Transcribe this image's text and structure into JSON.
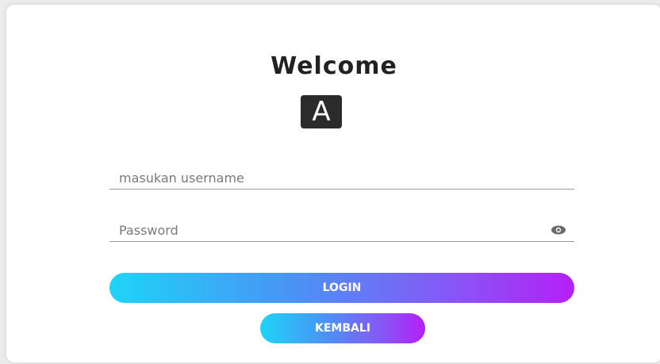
{
  "title": "Welcome",
  "logo": {
    "letter": "A"
  },
  "username": {
    "placeholder": "masukan username",
    "value": ""
  },
  "password": {
    "placeholder": "Password",
    "value": "",
    "toggle_icon": "eye-icon"
  },
  "buttons": {
    "login_label": "LOGIN",
    "back_label": "KEMBALI"
  },
  "colors": {
    "gradient_start": "#1fd4f7",
    "gradient_mid": "#4b92f5",
    "gradient_end": "#b41ff5",
    "logo_bg": "#2b2b2b"
  }
}
